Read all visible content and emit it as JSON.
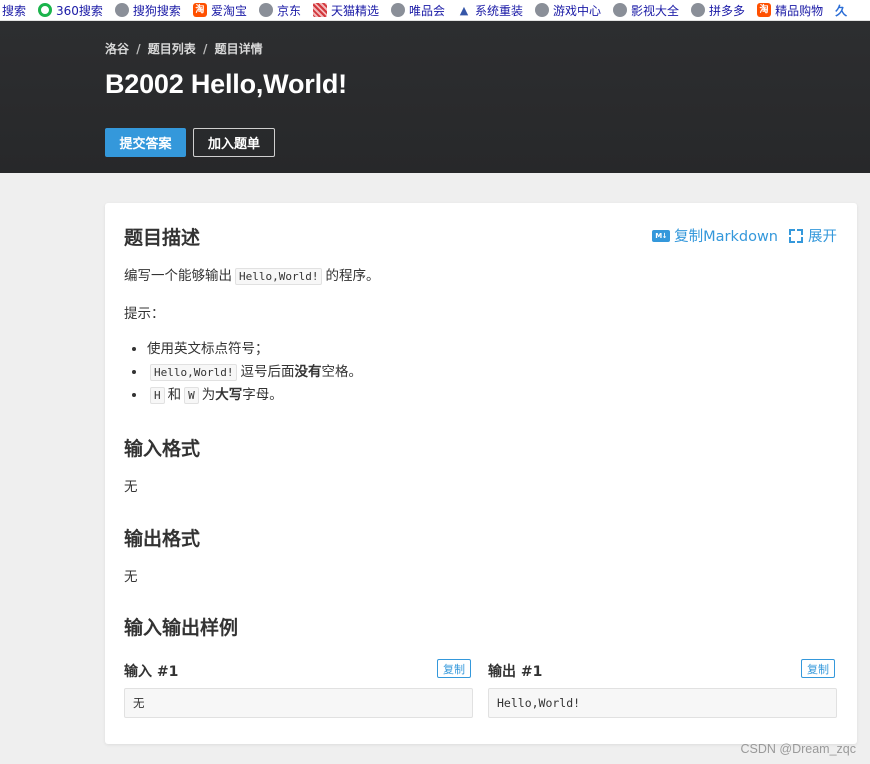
{
  "bookmarks": [
    {
      "label": "搜索",
      "icon": "none"
    },
    {
      "label": "360搜索",
      "icon": "360-icon"
    },
    {
      "label": "搜狗搜索",
      "icon": "globe-icon"
    },
    {
      "label": "爱淘宝",
      "icon": "taobao-icon",
      "glyph": "淘"
    },
    {
      "label": "京东",
      "icon": "globe-icon"
    },
    {
      "label": "天猫精选",
      "icon": "tmall-icon"
    },
    {
      "label": "唯品会",
      "icon": "globe-icon"
    },
    {
      "label": "系统重装",
      "icon": "hat-icon"
    },
    {
      "label": "游戏中心",
      "icon": "globe-icon"
    },
    {
      "label": "影视大全",
      "icon": "globe-icon"
    },
    {
      "label": "拼多多",
      "icon": "globe-icon"
    },
    {
      "label": "精品购物",
      "icon": "taobao-icon",
      "glyph": "淘"
    }
  ],
  "bookmarks_overflow": "久",
  "header": {
    "breadcrumb": [
      "洛谷",
      "题目列表",
      "题目详情"
    ],
    "breadcrumb_sep": "/",
    "title": "B2002 Hello,World!",
    "submit_label": "提交答案",
    "add_list_label": "加入题单"
  },
  "problem": {
    "desc_title": "题目描述",
    "copy_markdown_label": "复制Markdown",
    "md_badge": "M↓",
    "expand_label": "展开",
    "desc_before": "编写一个能够输出",
    "desc_code": "Hello,World!",
    "desc_after": "的程序。",
    "hint_title": "提示：",
    "hints": {
      "h1": "使用英文标点符号；",
      "h2_code": "Hello,World!",
      "h2_before": "逗号后面",
      "h2_bold": "没有",
      "h2_after": "空格。",
      "h3_code1": "H",
      "h3_mid": "和",
      "h3_code2": "W",
      "h3_before": "为",
      "h3_bold": "大写",
      "h3_after": "字母。"
    },
    "input_title": "输入格式",
    "input_text": "无",
    "output_title": "输出格式",
    "output_text": "无",
    "samples_title": "输入输出样例",
    "sample_input_label": "输入 #1",
    "sample_output_label": "输出 #1",
    "copy_label": "复制",
    "sample_input": "无",
    "sample_output": "Hello,World!"
  },
  "watermark": "CSDN @Dream_zqc",
  "colors": {
    "accent": "#3498db",
    "header_bg": "#2a2b2d",
    "page_bg": "#efefef"
  }
}
